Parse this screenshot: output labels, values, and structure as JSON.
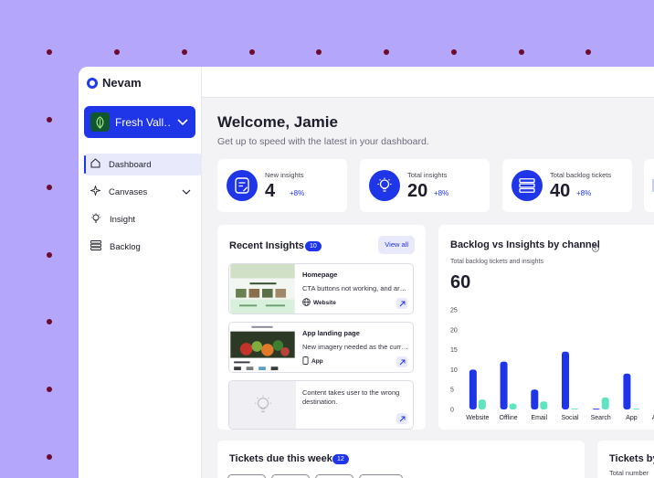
{
  "brand": {
    "name": "Nevam",
    "accent": "#1f35e8",
    "background": "#b3a6fb"
  },
  "org": {
    "name": "Fresh Vall…"
  },
  "sidebar": {
    "items": [
      {
        "label": "Dashboard",
        "icon": "home-icon",
        "active": true
      },
      {
        "label": "Canvases",
        "icon": "sparkle-icon",
        "has_chevron": true
      },
      {
        "label": "Insight",
        "icon": "lightbulb-icon"
      },
      {
        "label": "Backlog",
        "icon": "stack-icon"
      }
    ]
  },
  "header": {
    "welcome": "Welcome, Jamie",
    "subtitle": "Get up to speed with the latest in your dashboard."
  },
  "stats": [
    {
      "label": "New insights",
      "value": "4",
      "delta": "+8%",
      "icon": "document-icon"
    },
    {
      "label": "Total insights",
      "value": "20",
      "delta": "+8%",
      "icon": "lightbulb-icon"
    },
    {
      "label": "Total backlog tickets",
      "value": "40",
      "delta": "+8%",
      "icon": "stack-icon"
    }
  ],
  "recent_insights": {
    "title": "Recent Insights",
    "count": "10",
    "view_all": "View all",
    "items": [
      {
        "title": "Homepage",
        "description": "CTA buttons not working, and ar…",
        "tag": "Website",
        "tag_icon": "globe-icon"
      },
      {
        "title": "App landing page",
        "description": "New imagery needed as the curr…",
        "tag": "App",
        "tag_icon": "phone-icon"
      },
      {
        "title": "",
        "description": "Content takes user to the wrong destination.",
        "tag": "",
        "tag_icon": ""
      }
    ]
  },
  "chart": {
    "title": "Backlog vs Insights by channel",
    "subtitle": "Total backlog tickets and insights",
    "big_value": "60"
  },
  "chart_data": {
    "type": "bar",
    "title": "Backlog vs Insights by channel",
    "categories": [
      "Website",
      "Offline",
      "Email",
      "Social",
      "Search",
      "App",
      "Affiliate"
    ],
    "series": [
      {
        "values": [
          10,
          12,
          5,
          14.5,
          0.2,
          9,
          0.2
        ],
        "color": "#1f35e8"
      },
      {
        "values": [
          2.5,
          1.5,
          2,
          0.2,
          3,
          0.2,
          0.2
        ],
        "color": "#5fe3c0"
      }
    ],
    "yticks": [
      "0",
      "5",
      "10",
      "15",
      "20",
      "25"
    ],
    "ylim": [
      0,
      25
    ]
  },
  "tickets": {
    "title": "Tickets due this week",
    "count": "12"
  },
  "tickets_by": {
    "title": "Tickets by",
    "subtitle": "Total number"
  }
}
